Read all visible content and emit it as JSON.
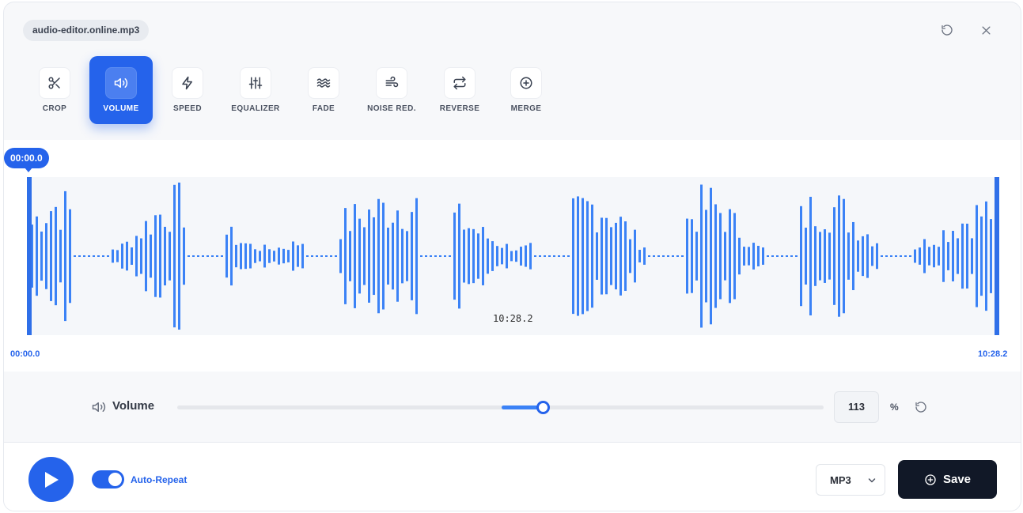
{
  "file_name": "audio-editor.online.mp3",
  "tools": [
    {
      "label": "CROP",
      "icon": "scissors-icon",
      "active": false
    },
    {
      "label": "VOLUME",
      "icon": "speaker-icon",
      "active": true
    },
    {
      "label": "SPEED",
      "icon": "lightning-icon",
      "active": false
    },
    {
      "label": "EQUALIZER",
      "icon": "sliders-icon",
      "active": false
    },
    {
      "label": "FADE",
      "icon": "waves-icon",
      "active": false
    },
    {
      "label": "NOISE RED.",
      "icon": "wind-icon",
      "active": false
    },
    {
      "label": "REVERSE",
      "icon": "repeat-icon",
      "active": false
    },
    {
      "label": "MERGE",
      "icon": "plus-circle-icon",
      "active": false
    }
  ],
  "waveform": {
    "current_time_bubble": "00:00.0",
    "cursor_time": "10:28.2",
    "start_time": "00:00.0",
    "end_time": "10:28.2",
    "color": "#3b82f6"
  },
  "volume": {
    "label": "Volume",
    "value": "113",
    "unit": "%",
    "level_fraction": 0.565
  },
  "playback": {
    "auto_repeat_label": "Auto-Repeat",
    "auto_repeat_on": true
  },
  "export": {
    "format": "MP3",
    "save_label": "Save"
  },
  "colors": {
    "accent": "#2563eb",
    "save_button": "#111827"
  }
}
